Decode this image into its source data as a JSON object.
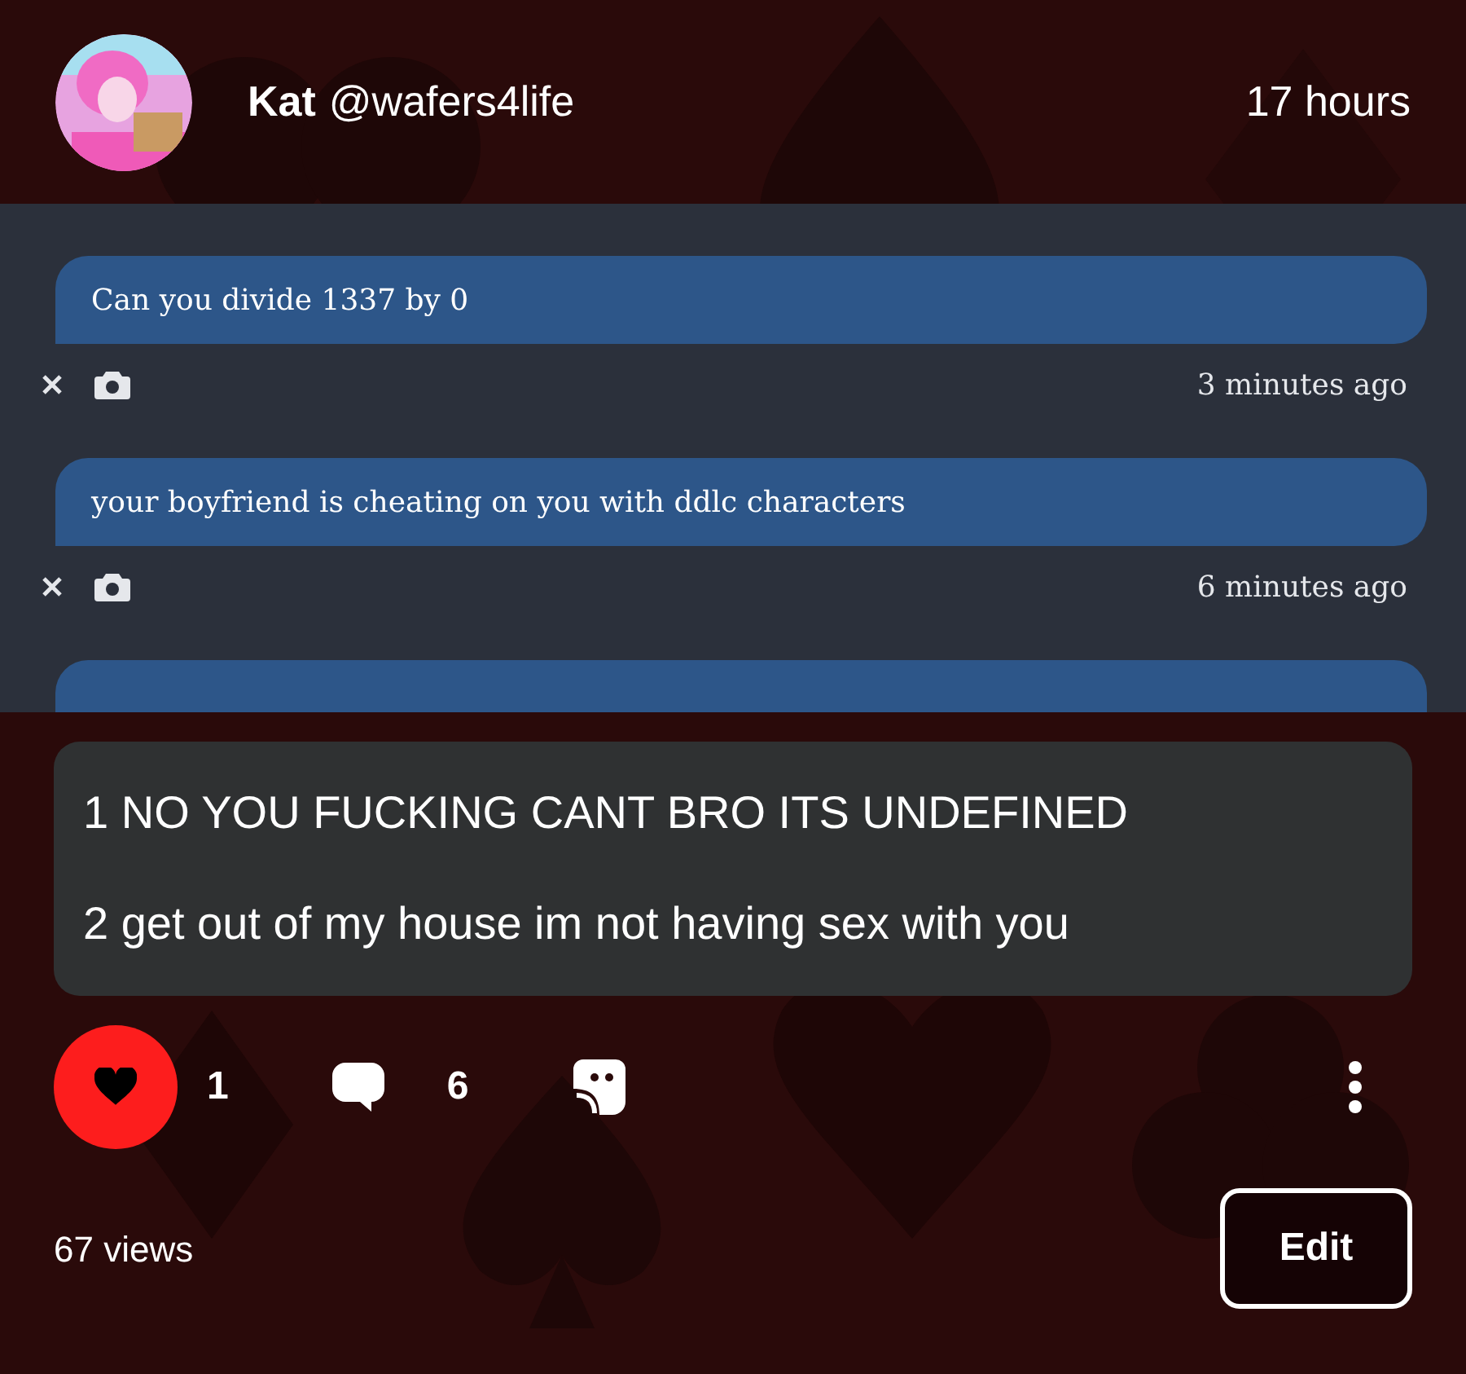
{
  "post": {
    "author": {
      "name": "Kat",
      "handle": "@wafers4life"
    },
    "time": "17 hours",
    "screenshot": {
      "messages": [
        {
          "text": "Can you divide 1337 by 0",
          "time": "3 minutes ago"
        },
        {
          "text": "your boyfriend is cheating on you with ddlc characters",
          "time": "6 minutes ago"
        }
      ],
      "more_below": true
    },
    "answer": [
      "1 NO YOU FUCKING CANT BRO ITS UNDEFINED",
      "2 get out of my house im not having sex with you"
    ],
    "actions": {
      "liked": true,
      "likes": "1",
      "comments": "6"
    },
    "views": "67 views",
    "edit_button": "Edit"
  }
}
